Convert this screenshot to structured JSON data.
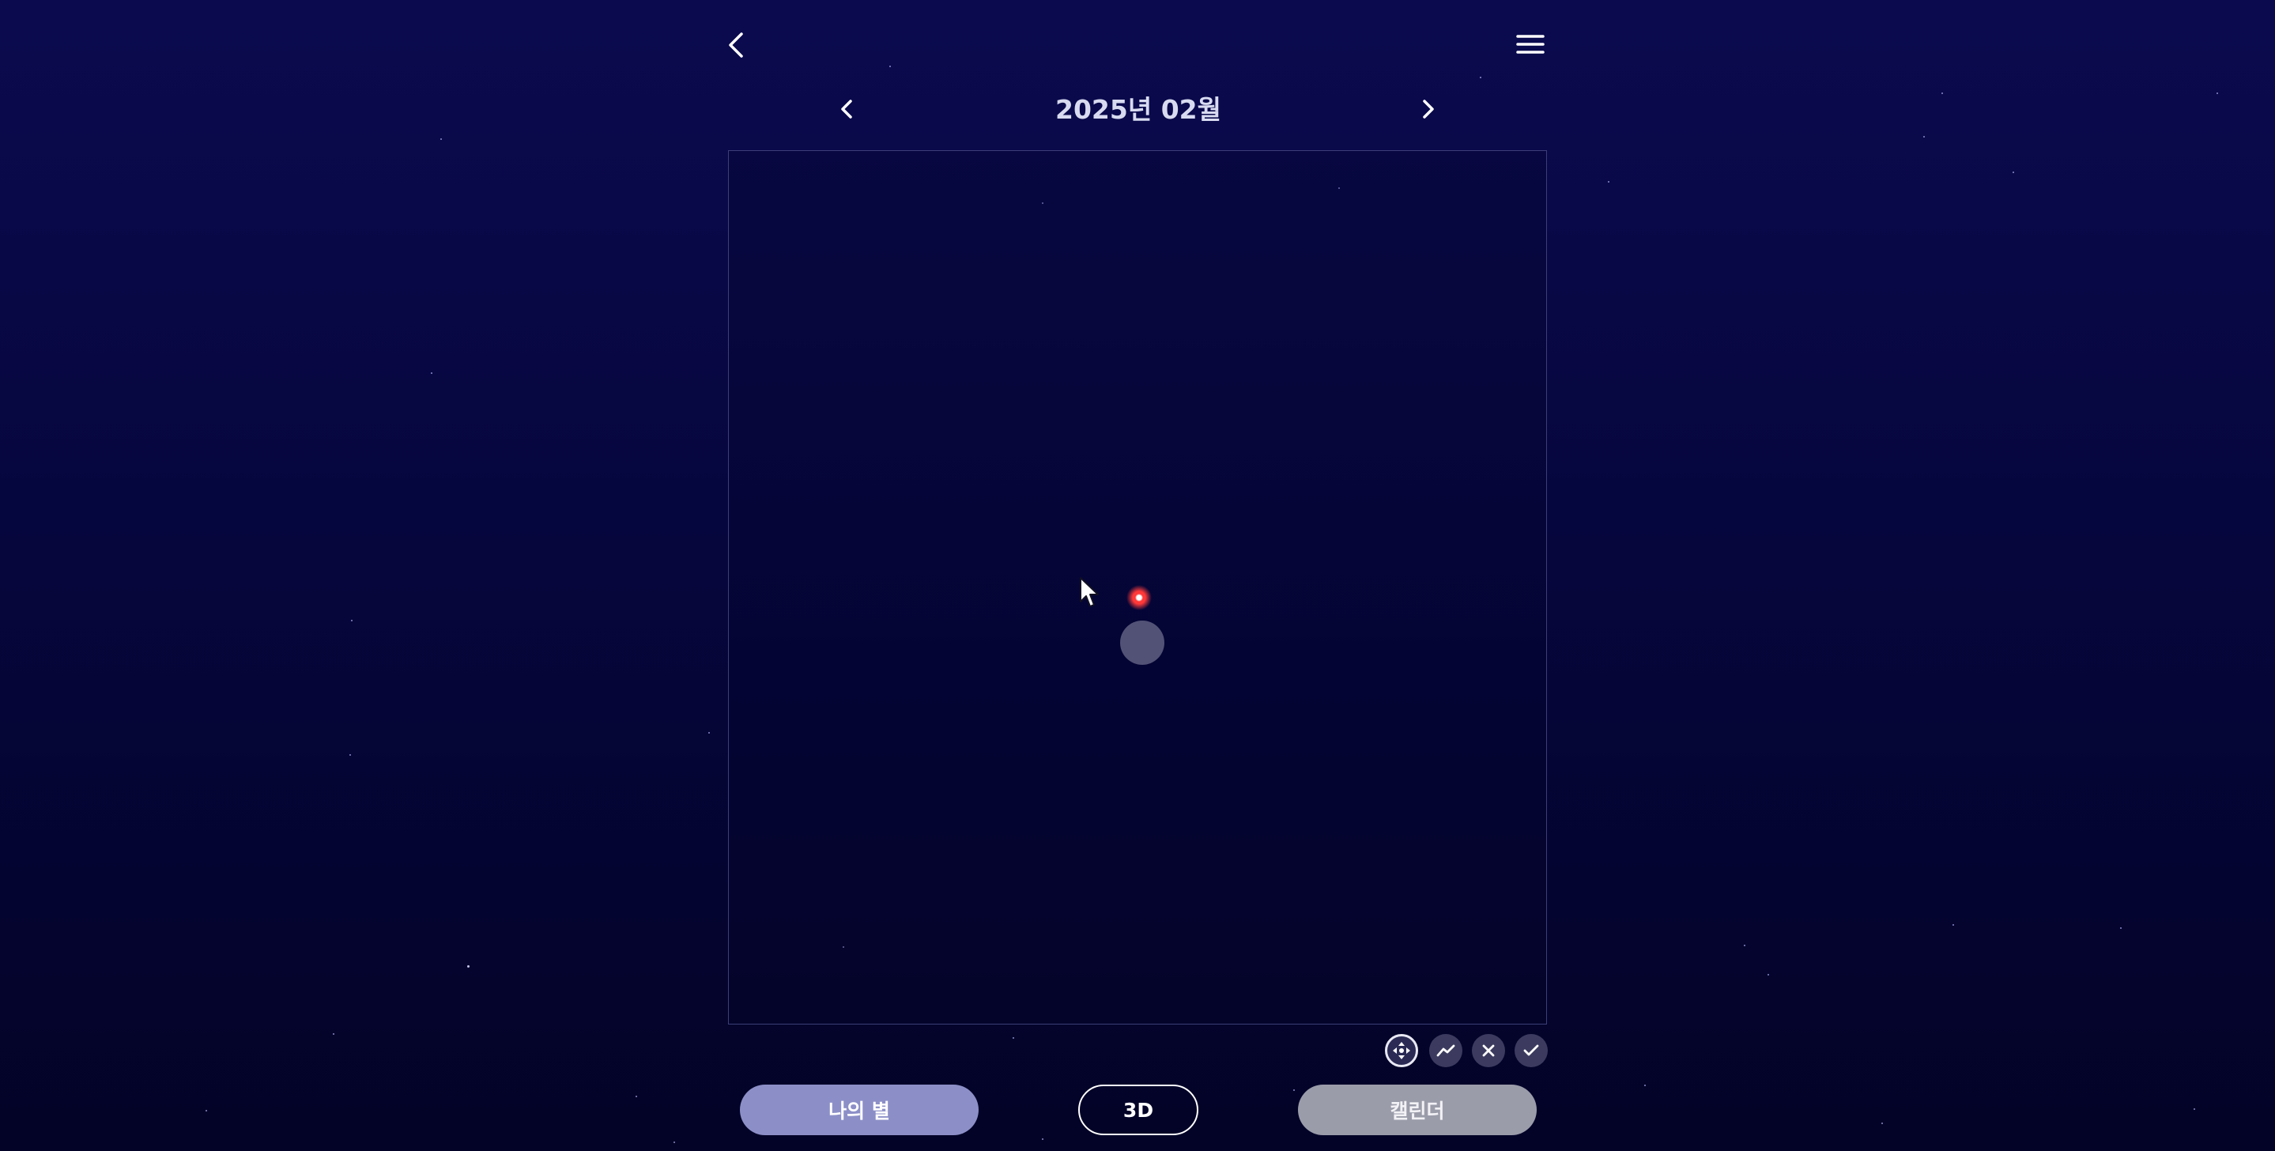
{
  "header": {
    "back_icon": "chevron-left-icon",
    "menu_icon": "hamburger-menu-icon"
  },
  "month_nav": {
    "title": "2025년 02월",
    "prev_icon": "chevron-left-icon",
    "next_icon": "chevron-right-icon"
  },
  "toolbar": {
    "tools": [
      {
        "icon": "move-arrows-icon",
        "active": true
      },
      {
        "icon": "line-chart-icon",
        "active": false
      },
      {
        "icon": "close-icon",
        "active": false
      },
      {
        "icon": "check-icon",
        "active": false
      }
    ]
  },
  "bottom": {
    "my_star_label": "나의 별",
    "three_d_label": "3D",
    "calendar_label": "캘린더"
  },
  "colors": {
    "background_top": "#0b0a4f",
    "background_bottom": "#030327",
    "my_star_button": "#8c8fc7",
    "calendar_button": "#9b9caa",
    "red_star": "#ff3838",
    "gray_orb": "#525277"
  }
}
